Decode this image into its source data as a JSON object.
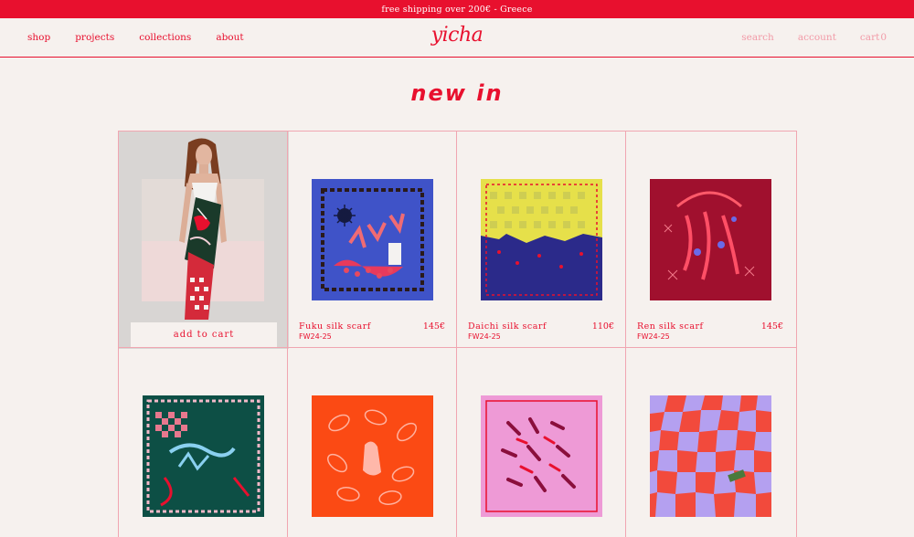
{
  "banner": {
    "text": "free shipping over 200€ - Greece"
  },
  "nav": {
    "left": [
      "shop",
      "projects",
      "collections",
      "about"
    ],
    "logo": "yicha",
    "right": {
      "search": "search",
      "account": "account",
      "cart": "cart",
      "cart_count": "0"
    }
  },
  "heading": "new in",
  "featured": {
    "add_to_cart": "add to cart"
  },
  "products": [
    {
      "name": "Fuku silk scarf",
      "price": "145€",
      "season": "FW24-25"
    },
    {
      "name": "Daichi silk scarf",
      "price": "110€",
      "season": "FW24-25"
    },
    {
      "name": "Ren silk scarf",
      "price": "145€",
      "season": "FW24-25"
    }
  ],
  "colors": {
    "accent": "#e8102e",
    "background": "#f6f1ee",
    "grid_line": "#f0a6b1"
  }
}
